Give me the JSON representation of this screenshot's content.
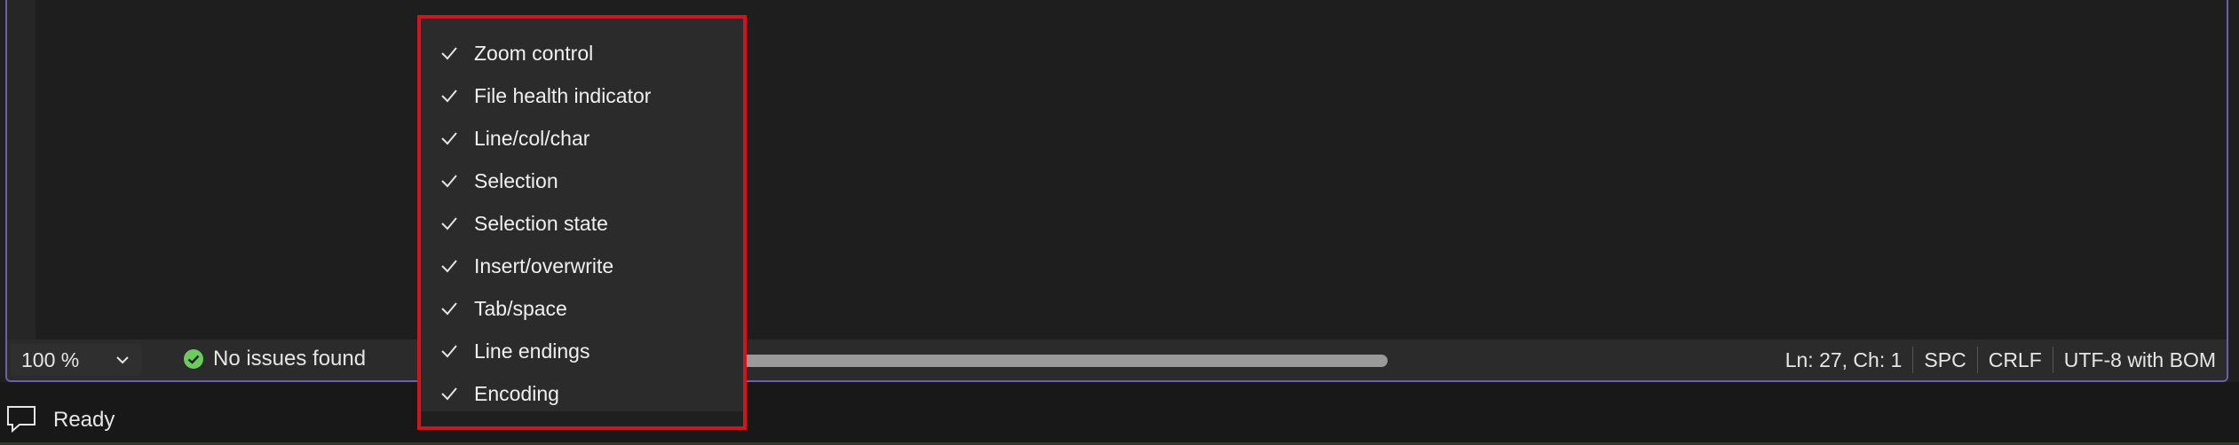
{
  "editor": {
    "zoom": {
      "value": "100 %",
      "icon": "chevron-down-icon"
    },
    "health": {
      "text": "No issues found",
      "icon": "check-circle-icon",
      "icon_color": "#6ccb5f"
    },
    "status_items": [
      {
        "id": "position",
        "label": "Ln: 27, Ch: 1"
      },
      {
        "id": "whitespace",
        "label": "SPC"
      },
      {
        "id": "line-endings",
        "label": "CRLF"
      },
      {
        "id": "encoding",
        "label": "UTF-8 with BOM"
      }
    ]
  },
  "context_menu": {
    "highlight_color": "#d4141c",
    "items": [
      {
        "label": "Zoom control",
        "checked": true
      },
      {
        "label": "File health indicator",
        "checked": true
      },
      {
        "label": "Line/col/char",
        "checked": true
      },
      {
        "label": "Selection",
        "checked": true
      },
      {
        "label": "Selection state",
        "checked": true
      },
      {
        "label": "Insert/overwrite",
        "checked": true
      },
      {
        "label": "Tab/space",
        "checked": true
      },
      {
        "label": "Line endings",
        "checked": true
      },
      {
        "label": "Encoding",
        "checked": true
      }
    ]
  },
  "bottom_bar": {
    "status": "Ready",
    "icon": "chat-bubble-icon"
  },
  "colors": {
    "frame_border": "#6d5fa8",
    "background": "#1f1f1f",
    "accent_green": "#6ccb5f"
  }
}
